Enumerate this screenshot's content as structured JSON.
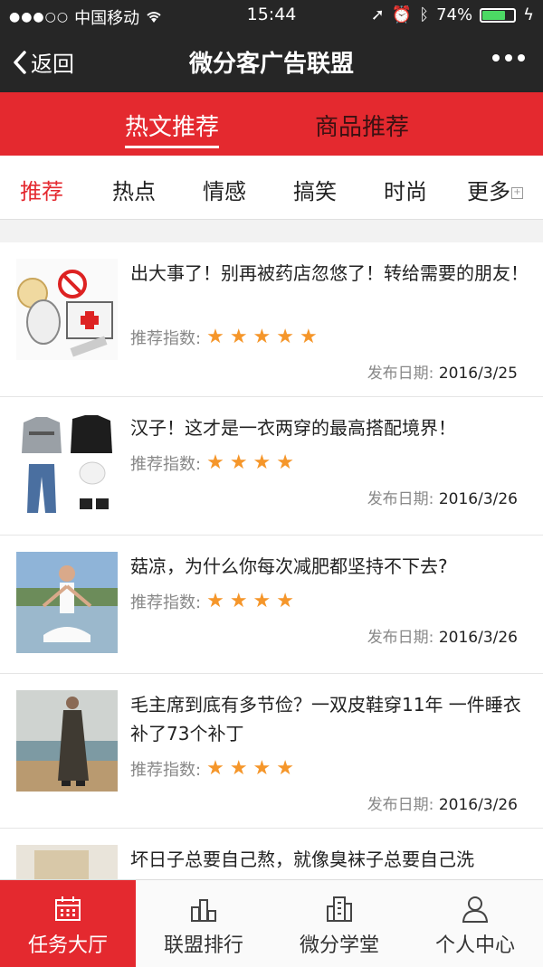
{
  "status": {
    "carrier": "中国移动",
    "time": "15:44",
    "battery": "74%",
    "battery_level": 0.74
  },
  "nav": {
    "back_label": "返回",
    "title": "微分客广告联盟"
  },
  "top_tabs": [
    {
      "label": "热文推荐",
      "active": true
    },
    {
      "label": "商品推荐",
      "active": false
    }
  ],
  "categories": [
    {
      "label": "推荐",
      "active": true
    },
    {
      "label": "热点"
    },
    {
      "label": "情感"
    },
    {
      "label": "搞笑"
    },
    {
      "label": "时尚"
    },
    {
      "label": "更多"
    }
  ],
  "articles": [
    {
      "title": "出大事了！别再被药店忽悠了！转给需要的朋友！",
      "rating_label": "推荐指数:",
      "stars": 5,
      "date_label": "发布日期:",
      "date": "2016/3/25"
    },
    {
      "title": "汉子！这才是一衣两穿的最高搭配境界！",
      "rating_label": "推荐指数:",
      "stars": 4,
      "date_label": "发布日期:",
      "date": "2016/3/26"
    },
    {
      "title": "菇凉，为什么你每次减肥都坚持不下去?",
      "rating_label": "推荐指数:",
      "stars": 4,
      "date_label": "发布日期:",
      "date": "2016/3/26"
    },
    {
      "title": "毛主席到底有多节俭？一双皮鞋穿11年 一件睡衣补了73个补丁",
      "rating_label": "推荐指数:",
      "stars": 4,
      "date_label": "发布日期:",
      "date": "2016/3/26"
    },
    {
      "title": "坏日子总要自己熬，就像臭袜子总要自己洗"
    }
  ],
  "tabbar": [
    {
      "label": "任务大厅",
      "icon": "calendar-icon",
      "active": true
    },
    {
      "label": "联盟排行",
      "icon": "ranking-icon"
    },
    {
      "label": "微分学堂",
      "icon": "building-icon"
    },
    {
      "label": "个人中心",
      "icon": "person-icon"
    }
  ],
  "colors": {
    "accent": "#e4292f",
    "star": "#f5962a",
    "dark": "#262626"
  }
}
